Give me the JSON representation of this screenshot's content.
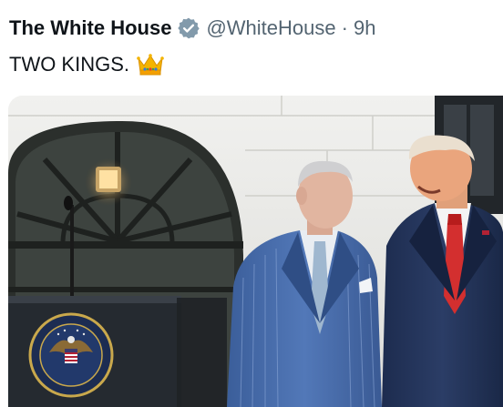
{
  "tweet": {
    "display_name": "The White House",
    "verified_icon": "verified-badge-icon",
    "handle": "@WhiteHouse",
    "separator": "·",
    "time": "9h",
    "text": "TWO KINGS.",
    "emoji": "crown-emoji-icon"
  },
  "media": {
    "kind": "photo",
    "seal_icon": "presidential-seal-icon"
  },
  "colors": {
    "name": "#0f1419",
    "muted": "#536471",
    "verified_badge": "#829aab"
  }
}
